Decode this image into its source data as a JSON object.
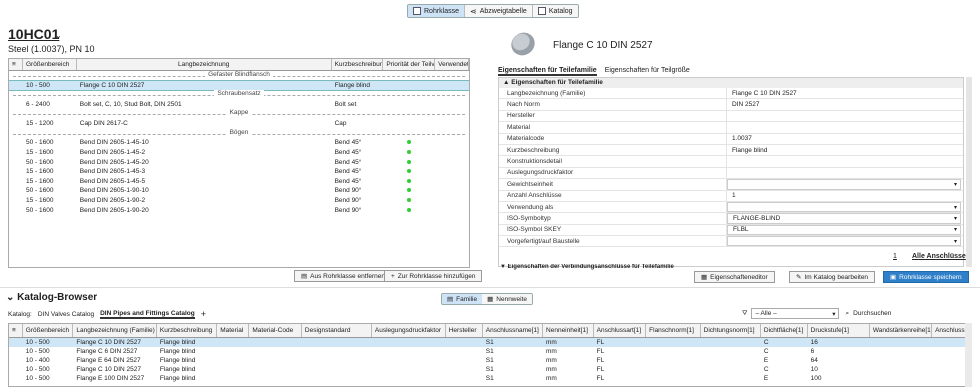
{
  "topbar": {
    "tabs": [
      {
        "label": "Rohrklasse",
        "icon": "table-icon",
        "active": true
      },
      {
        "label": "Abzweigtabelle",
        "icon": "branch-icon",
        "active": false
      },
      {
        "label": "Katalog",
        "icon": "catalog-icon",
        "active": false
      }
    ]
  },
  "left": {
    "title": "10HC01",
    "subtitle": "Steel (1.0037), PN 10",
    "columns": [
      "Größenbereich",
      "Langbezeichnung",
      "Kurzbeschreibung",
      "Priorität der Teilve",
      "Verwendeter"
    ],
    "rows": [
      {
        "type": "sep",
        "label": "Gefaster Blindflansch"
      },
      {
        "type": "row",
        "size": "10 - 500",
        "name": "Flange C 10 DIN 2527",
        "short": "Flange blind",
        "dot": false,
        "selected": true
      },
      {
        "type": "sep",
        "label": "Schraubensatz"
      },
      {
        "type": "row",
        "size": "6 - 2400",
        "name": "Bolt set, C, 10, Stud Bolt, DIN 2501",
        "short": "Bolt set",
        "dot": false
      },
      {
        "type": "sep",
        "label": "Kappe"
      },
      {
        "type": "row",
        "size": "15 - 1200",
        "name": "Cap DIN 2617-C",
        "short": "Cap",
        "dot": false
      },
      {
        "type": "sep",
        "label": "Bögen"
      },
      {
        "type": "row",
        "size": "50 - 1600",
        "name": "Bend DIN 2605-1-45-10",
        "short": "Bend 45°",
        "dot": true
      },
      {
        "type": "row",
        "size": "15 - 1600",
        "name": "Bend DIN 2605-1-45-2",
        "short": "Bend 45°",
        "dot": true
      },
      {
        "type": "row",
        "size": "50 - 1600",
        "name": "Bend DIN 2605-1-45-20",
        "short": "Bend 45°",
        "dot": true
      },
      {
        "type": "row",
        "size": "15 - 1600",
        "name": "Bend DIN 2605-1-45-3",
        "short": "Bend 45°",
        "dot": true
      },
      {
        "type": "row",
        "size": "15 - 1600",
        "name": "Bend DIN 2605-1-45-5",
        "short": "Bend 45°",
        "dot": true
      },
      {
        "type": "row",
        "size": "50 - 1600",
        "name": "Bend DIN 2605-1-90-10",
        "short": "Bend 90°",
        "dot": true
      },
      {
        "type": "row",
        "size": "15 - 1600",
        "name": "Bend DIN 2605-1-90-2",
        "short": "Bend 90°",
        "dot": true
      },
      {
        "type": "row",
        "size": "50 - 1600",
        "name": "Bend DIN 2605-1-90-20",
        "short": "Bend 90°",
        "dot": true
      }
    ],
    "btn_remove": "Aus Rohrklasse entfernen",
    "btn_add": "Zur Rohrklasse hinzufügen"
  },
  "right": {
    "title": "Flange C 10 DIN 2527",
    "tabs": [
      "Eigenschaften für Teilefamilie",
      "Eigenschaften für Teilgröße"
    ],
    "section": "Eigenschaften für Teilefamilie",
    "props": [
      {
        "k": "Langbezeichnung (Familie)",
        "v": "Flange C 10 DIN 2527",
        "dd": false
      },
      {
        "k": "Nach Norm",
        "v": "DIN 2527",
        "dd": false
      },
      {
        "k": "Hersteller",
        "v": "",
        "dd": false
      },
      {
        "k": "Material",
        "v": "",
        "dd": false
      },
      {
        "k": "Materialcode",
        "v": "1.0037",
        "dd": false
      },
      {
        "k": "Kurzbeschreibung",
        "v": "Flange blind",
        "dd": false
      },
      {
        "k": "Konstruktionsdetail",
        "v": "",
        "dd": false
      },
      {
        "k": "Auslegungsdruckfaktor",
        "v": "",
        "dd": false
      },
      {
        "k": "Gewichtseinheit",
        "v": "",
        "dd": true
      },
      {
        "k": "Anzahl Anschlüsse",
        "v": "1",
        "dd": false
      },
      {
        "k": "Verwendung als",
        "v": "",
        "dd": true
      },
      {
        "k": "ISO-Symboltyp",
        "v": "FLANGE-BLIND",
        "dd": true
      },
      {
        "k": "ISO-Symbol SKEY",
        "v": "FLBL",
        "dd": true
      },
      {
        "k": "Vorgefertigt/auf Baustelle",
        "v": "",
        "dd": true
      }
    ],
    "one": "1",
    "alle": "Alle Anschlüsse",
    "section2": "Eigenschaften der Verbindungsanschlüsse für Teilefamilie",
    "btn_editor": "Eigenschafteneditor",
    "btn_edit": "Im Katalog bearbeiten",
    "btn_save": "Rohrklasse speichern"
  },
  "bottom": {
    "title": "Katalog-Browser",
    "seg": [
      {
        "label": "Familie",
        "active": true
      },
      {
        "label": "Nennweite",
        "active": false
      }
    ],
    "katalog_label": "Katalog:",
    "catalogs": [
      {
        "label": "DIN Valves Catalog",
        "active": false
      },
      {
        "label": "DIN Pipes and Fittings Catalog",
        "active": true
      }
    ],
    "add": "+",
    "filter_value": "– Alle –",
    "search_placeholder": "Durchsuchen",
    "columns": [
      "Größenbereich",
      "Langbezeichnung (Familie)",
      "Kurzbeschreibung",
      "Material",
      "Material-Code",
      "Designstandard",
      "Auslegungsdruckfaktor",
      "Hersteller",
      "Anschlussname[1]",
      "Nenneinheit[1]",
      "Anschlussart[1]",
      "Flanschnorm[1]",
      "Dichtungsnorm[1]",
      "Dichtfläche[1]",
      "Druckstufe[1]",
      "Wandstärkenreihe[1]",
      "Anschluss"
    ],
    "rows": [
      {
        "c": [
          "10 - 500",
          "Flange C 10 DIN 2527",
          "Flange blind",
          "",
          "",
          "",
          "",
          "",
          "S1",
          "mm",
          "FL",
          "",
          "",
          "C",
          "16",
          "",
          ""
        ],
        "sel": true
      },
      {
        "c": [
          "10 - 500",
          "Flange C 6 DIN 2527",
          "Flange blind",
          "",
          "",
          "",
          "",
          "",
          "S1",
          "mm",
          "FL",
          "",
          "",
          "C",
          "6",
          "",
          ""
        ]
      },
      {
        "c": [
          "10 - 400",
          "Flange E 64 DIN 2527",
          "Flange blind",
          "",
          "",
          "",
          "",
          "",
          "S1",
          "mm",
          "FL",
          "",
          "",
          "E",
          "64",
          "",
          ""
        ]
      },
      {
        "c": [
          "10 - 500",
          "Flange C 10 DIN 2527",
          "Flange blind",
          "",
          "",
          "",
          "",
          "",
          "S1",
          "mm",
          "FL",
          "",
          "",
          "C",
          "10",
          "",
          ""
        ]
      },
      {
        "c": [
          "10 - 500",
          "Flange E 100 DIN 2527",
          "Flange blind",
          "",
          "",
          "",
          "",
          "",
          "S1",
          "mm",
          "FL",
          "",
          "",
          "E",
          "100",
          "",
          ""
        ]
      }
    ]
  }
}
